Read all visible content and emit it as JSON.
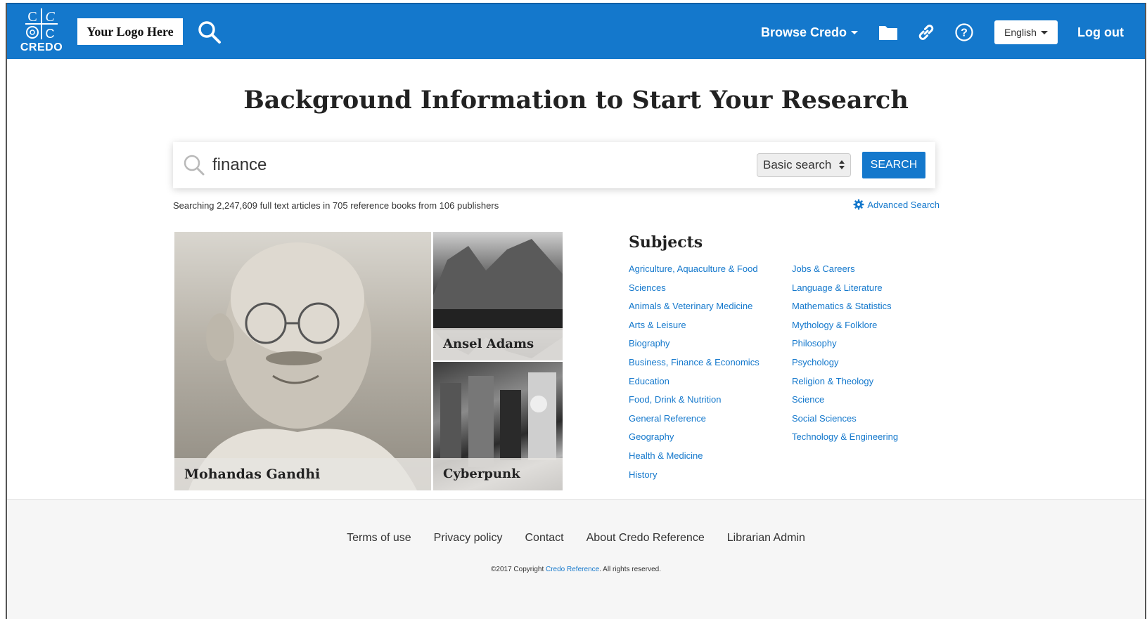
{
  "header": {
    "brand_text": "CREDO",
    "logo_placeholder": "Your Logo Here",
    "browse_label": "Browse Credo",
    "language": "English",
    "logout_label": "Log out",
    "icons": [
      "search-icon",
      "folder-icon",
      "link-icon",
      "help-icon"
    ],
    "bg_color": "#1478cc"
  },
  "main": {
    "title": "Background Information to Start Your Research",
    "search": {
      "value": "finance",
      "type": "Basic search",
      "button": "SEARCH"
    },
    "stats": "Searching 2,247,609 full text articles in 705 reference books from 106 publishers",
    "advanced_search": "Advanced Search"
  },
  "features": [
    {
      "caption": "Mohandas Gandhi"
    },
    {
      "caption": "Ansel Adams"
    },
    {
      "caption": "Cyberpunk"
    }
  ],
  "subjects": {
    "title": "Subjects",
    "col1": [
      "Agriculture, Aquaculture & Food",
      "Sciences",
      "Animals & Veterinary Medicine",
      "Arts & Leisure",
      "Biography",
      "Business, Finance & Economics",
      "Education",
      "Food, Drink & Nutrition",
      "General Reference",
      "Geography",
      "Health & Medicine",
      "History"
    ],
    "col2": [
      "Jobs & Careers",
      "Language & Literature",
      "Mathematics & Statistics",
      "Mythology & Folklore",
      "Philosophy",
      "Psychology",
      "Religion & Theology",
      "Science",
      "Social Sciences",
      "Technology & Engineering"
    ]
  },
  "footer": {
    "links": [
      "Terms of use",
      "Privacy policy",
      "Contact",
      "About Credo Reference",
      "Librarian Admin"
    ],
    "copyright_prefix": "©2017 Copyright ",
    "copyright_link": "Credo Reference",
    "copyright_suffix": ". All rights reserved."
  }
}
